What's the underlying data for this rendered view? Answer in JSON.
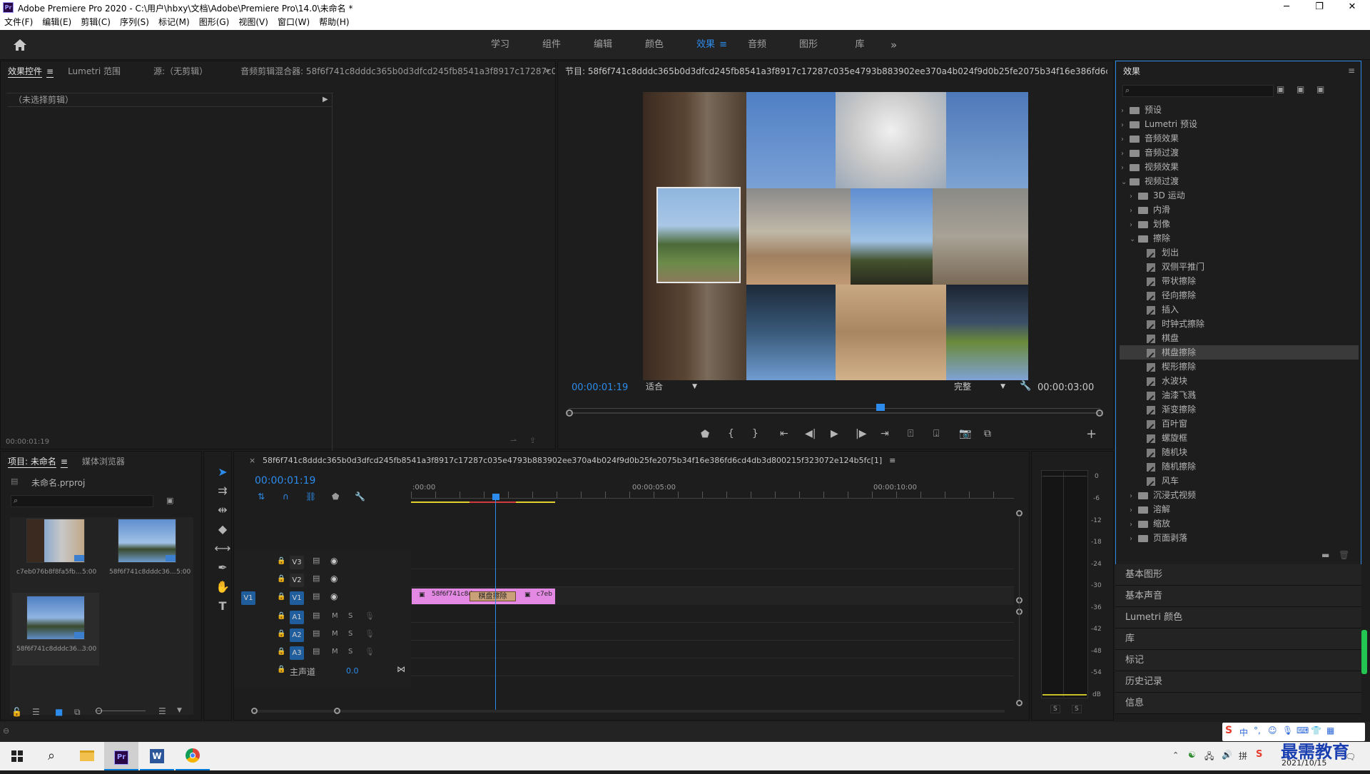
{
  "window": {
    "title": "Adobe Premiere Pro 2020 - C:\\用户\\hbxy\\文档\\Adobe\\Premiere Pro\\14.0\\未命名 *",
    "app_badge": "Pr"
  },
  "menu": [
    "文件(F)",
    "编辑(E)",
    "剪辑(C)",
    "序列(S)",
    "标记(M)",
    "图形(G)",
    "视图(V)",
    "窗口(W)",
    "帮助(H)"
  ],
  "workspaces": [
    {
      "label": "学习",
      "active": false
    },
    {
      "label": "组件",
      "active": false
    },
    {
      "label": "编辑",
      "active": false
    },
    {
      "label": "颜色",
      "active": false
    },
    {
      "label": "效果",
      "active": true
    },
    {
      "label": "音频",
      "active": false
    },
    {
      "label": "图形",
      "active": false
    },
    {
      "label": "库",
      "active": false
    }
  ],
  "workspace_more": "»",
  "source_panel": {
    "tabs": [
      "效果控件",
      "Lumetri 范围",
      "源:（无剪辑）",
      "音频剪辑混合器: 58f6f741c8dddc365b0d3dfcd245fb8541a3f8917c17287c035e4"
    ],
    "no_clip": "（未选择剪辑）",
    "timecode": "00:00:01:19"
  },
  "program": {
    "title": "节目: 58f6f741c8dddc365b0d3dfcd245fb8541a3f8917c17287c035e4793b883902ee370a4b024f9d0b25fe2075b34f16e386fd6cd4db3d800215f323072e124b",
    "timecode": "00:00:01:19",
    "fit": "适合",
    "quality": "完整",
    "duration": "00:00:03:00"
  },
  "project": {
    "tabs": [
      "项目: 未命名",
      "媒体浏览器"
    ],
    "file": "未命名.prproj",
    "items": [
      {
        "name": "c7eb076b8f8fa5fb...",
        "dur": "5:00"
      },
      {
        "name": "58f6f741c8dddc36...",
        "dur": "5:00"
      },
      {
        "name": "58f6f741c8dddc36...",
        "dur": "3:00"
      }
    ]
  },
  "timeline": {
    "title": "58f6f741c8dddc365b0d3dfcd245fb8541a3f8917c17287c035e4793b883902ee370a4b024f9d0b25fe2075b34f16e386fd6cd4db3d800215f323072e124b5fc[1]",
    "timecode": "00:00:01:19",
    "ruler": [
      ":00:00",
      "00:00:05:00",
      "00:00:10:00"
    ],
    "video_tracks": [
      "V3",
      "V2",
      "V1"
    ],
    "audio_tracks": [
      "A1",
      "A2",
      "A3"
    ],
    "source_patch": "V1",
    "mute": "M",
    "solo": "S",
    "master": "主声道",
    "master_val": "0.0",
    "clip_a": "58f6f741c8d",
    "clip_b": "c7eb",
    "transition": "棋盘擦除"
  },
  "meter": {
    "scale": [
      "0",
      "-6",
      "-12",
      "-18",
      "-24",
      "-30",
      "-36",
      "-42",
      "-48",
      "-54",
      "dB"
    ],
    "solo": [
      "S",
      "S"
    ]
  },
  "effects": {
    "title": "效果",
    "tree": [
      {
        "label": "预设",
        "level": 0,
        "type": "folder",
        "open": false
      },
      {
        "label": "Lumetri 预设",
        "level": 0,
        "type": "folder",
        "open": false
      },
      {
        "label": "音频效果",
        "level": 0,
        "type": "folder",
        "open": false
      },
      {
        "label": "音频过渡",
        "level": 0,
        "type": "folder",
        "open": false
      },
      {
        "label": "视频效果",
        "level": 0,
        "type": "folder",
        "open": false
      },
      {
        "label": "视频过渡",
        "level": 0,
        "type": "folder",
        "open": true
      },
      {
        "label": "3D 运动",
        "level": 1,
        "type": "folder",
        "open": false
      },
      {
        "label": "内滑",
        "level": 1,
        "type": "folder",
        "open": false
      },
      {
        "label": "划像",
        "level": 1,
        "type": "folder",
        "open": false
      },
      {
        "label": "擦除",
        "level": 1,
        "type": "folder",
        "open": true
      },
      {
        "label": "划出",
        "level": 2,
        "type": "effect"
      },
      {
        "label": "双侧平推门",
        "level": 2,
        "type": "effect"
      },
      {
        "label": "带状擦除",
        "level": 2,
        "type": "effect"
      },
      {
        "label": "径向擦除",
        "level": 2,
        "type": "effect"
      },
      {
        "label": "插入",
        "level": 2,
        "type": "effect"
      },
      {
        "label": "时钟式擦除",
        "level": 2,
        "type": "effect"
      },
      {
        "label": "棋盘",
        "level": 2,
        "type": "effect"
      },
      {
        "label": "棋盘擦除",
        "level": 2,
        "type": "effect",
        "selected": true
      },
      {
        "label": "楔形擦除",
        "level": 2,
        "type": "effect"
      },
      {
        "label": "水波块",
        "level": 2,
        "type": "effect"
      },
      {
        "label": "油漆飞溅",
        "level": 2,
        "type": "effect"
      },
      {
        "label": "渐变擦除",
        "level": 2,
        "type": "effect"
      },
      {
        "label": "百叶窗",
        "level": 2,
        "type": "effect"
      },
      {
        "label": "螺旋框",
        "level": 2,
        "type": "effect"
      },
      {
        "label": "随机块",
        "level": 2,
        "type": "effect"
      },
      {
        "label": "随机擦除",
        "level": 2,
        "type": "effect"
      },
      {
        "label": "风车",
        "level": 2,
        "type": "effect"
      },
      {
        "label": "沉浸式视频",
        "level": 1,
        "type": "folder",
        "open": false
      },
      {
        "label": "溶解",
        "level": 1,
        "type": "folder",
        "open": false
      },
      {
        "label": "缩放",
        "level": 1,
        "type": "folder",
        "open": false
      },
      {
        "label": "页面剥落",
        "level": 1,
        "type": "folder",
        "open": false
      }
    ]
  },
  "side_panels": [
    "基本图形",
    "基本声音",
    "Lumetri 颜色",
    "库",
    "标记",
    "历史记录",
    "信息"
  ],
  "systray": {
    "ime": "中",
    "watermark": "最需教育",
    "date": "2021/10/15"
  },
  "colors": {
    "accent": "#2d8ceb",
    "clip": "#e389e3",
    "transition": "#c9a078",
    "panel": "#1d1d1d"
  }
}
